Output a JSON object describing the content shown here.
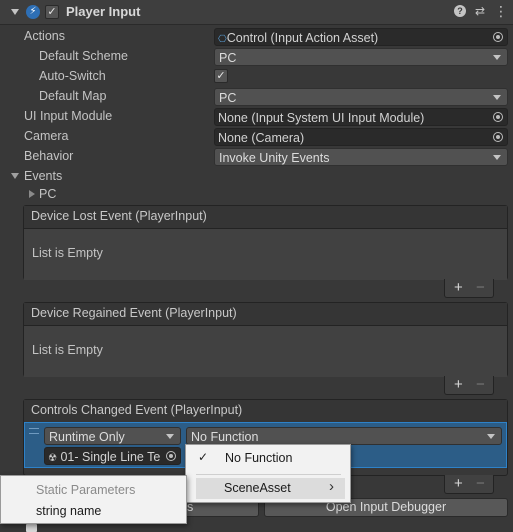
{
  "component": {
    "title": "Player Input",
    "enabled": true
  },
  "fields": {
    "actions": {
      "label": "Actions",
      "value": "Control (Input Action Asset)"
    },
    "default_scheme": {
      "label": "Default Scheme",
      "value": "PC"
    },
    "auto_switch": {
      "label": "Auto-Switch",
      "checked": true
    },
    "default_map": {
      "label": "Default Map",
      "value": "PC"
    },
    "ui_input_module": {
      "label": "UI Input Module",
      "value": "None (Input System UI Input Module)"
    },
    "camera": {
      "label": "Camera",
      "value": "None (Camera)"
    },
    "behavior": {
      "label": "Behavior",
      "value": "Invoke Unity Events"
    }
  },
  "events": {
    "label": "Events",
    "group": "PC",
    "device_lost": {
      "title": "Device Lost Event (PlayerInput)",
      "empty": "List is Empty"
    },
    "device_regained": {
      "title": "Device Regained Event (PlayerInput)",
      "empty": "List is Empty"
    },
    "controls_changed": {
      "title": "Controls Changed Event (PlayerInput)",
      "call_state": "Runtime Only",
      "function": "No Function",
      "object": "01-  Single Line Te"
    }
  },
  "footer": {
    "partial_button": "s",
    "debugger_button": "Open Input Debugger"
  },
  "function_menu": {
    "no_function": "No Function",
    "scene_asset": "SceneAsset",
    "check": "✓",
    "submenu_arrow": "›"
  },
  "sub_menu": {
    "header": "Static Parameters",
    "item": "string name"
  },
  "icons": {
    "plus": "+",
    "minus": "−",
    "check": "✓",
    "help": "?",
    "more": "⋮"
  },
  "colors": {
    "selection": "#2c5d87",
    "accent": "#2d82c9"
  }
}
